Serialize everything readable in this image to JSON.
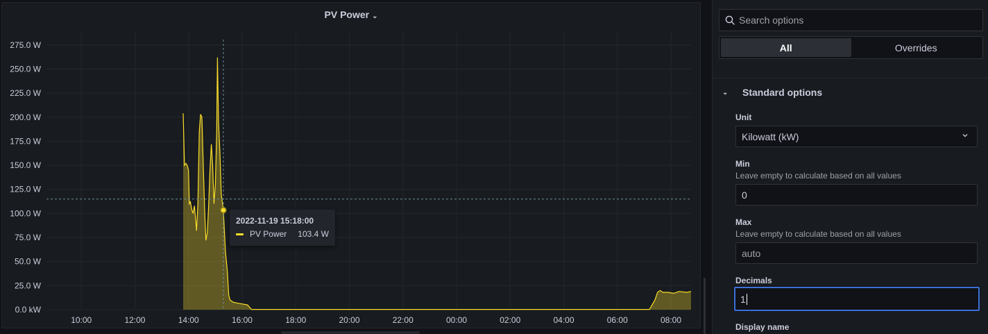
{
  "panel": {
    "title": "PV Power"
  },
  "tooltip": {
    "time": "2022-11-19 15:18:00",
    "series_name": "PV Power",
    "value": "103.4 W"
  },
  "options": {
    "search_placeholder": "Search options",
    "tabs": [
      {
        "label": "All",
        "active": true
      },
      {
        "label": "Overrides",
        "active": false
      }
    ],
    "section_title": "Standard options",
    "unit": {
      "label": "Unit",
      "value": "Kilowatt (kW)"
    },
    "min": {
      "label": "Min",
      "description": "Leave empty to calculate based on all values",
      "value": "0"
    },
    "max": {
      "label": "Max",
      "description": "Leave empty to calculate based on all values",
      "placeholder": "auto"
    },
    "decimals": {
      "label": "Decimals",
      "value": "1"
    },
    "display_name": {
      "label": "Display name"
    }
  },
  "colors": {
    "series": "#fade2a",
    "accent_focus": "#3d71d9",
    "background": "#111217",
    "panel": "#181b1f"
  },
  "chart_data": {
    "type": "area",
    "title": "PV Power",
    "series": [
      {
        "name": "PV Power",
        "x_unit": "hours since 2022-11-19 00:00",
        "points": [
          [
            13.8,
            204
          ],
          [
            13.85,
            150
          ],
          [
            13.9,
            152
          ],
          [
            13.95,
            150
          ],
          [
            14.0,
            145
          ],
          [
            14.03,
            110
          ],
          [
            14.07,
            112
          ],
          [
            14.12,
            104
          ],
          [
            14.17,
            100
          ],
          [
            14.22,
            108
          ],
          [
            14.27,
            92
          ],
          [
            14.3,
            82
          ],
          [
            14.35,
            110
          ],
          [
            14.4,
            185
          ],
          [
            14.45,
            203
          ],
          [
            14.5,
            200
          ],
          [
            14.55,
            150
          ],
          [
            14.6,
            105
          ],
          [
            14.65,
            72
          ],
          [
            14.7,
            80
          ],
          [
            14.75,
            108
          ],
          [
            14.8,
            145
          ],
          [
            14.85,
            172
          ],
          [
            14.9,
            150
          ],
          [
            14.95,
            110
          ],
          [
            15.0,
            130
          ],
          [
            15.05,
            185
          ],
          [
            15.08,
            262
          ],
          [
            15.12,
            195
          ],
          [
            15.17,
            165
          ],
          [
            15.22,
            120
          ],
          [
            15.3,
            103.4
          ],
          [
            15.38,
            60
          ],
          [
            15.45,
            40
          ],
          [
            15.5,
            15
          ],
          [
            15.55,
            10
          ],
          [
            15.65,
            8
          ],
          [
            15.8,
            7
          ],
          [
            16.0,
            6
          ],
          [
            16.2,
            5
          ],
          [
            16.35,
            0.3
          ],
          [
            17.0,
            0.3
          ],
          [
            20.0,
            0.3
          ],
          [
            23.0,
            0.3
          ],
          [
            26.0,
            0.3
          ],
          [
            29.0,
            0.3
          ],
          [
            31.2,
            0.3
          ],
          [
            31.4,
            10
          ],
          [
            31.5,
            18
          ],
          [
            31.6,
            20
          ],
          [
            31.7,
            18
          ],
          [
            31.9,
            18
          ],
          [
            32.1,
            17
          ],
          [
            32.3,
            19
          ],
          [
            32.6,
            18
          ],
          [
            32.75,
            19
          ]
        ]
      }
    ],
    "x_ticks": [
      "10:00",
      "12:00",
      "14:00",
      "16:00",
      "18:00",
      "20:00",
      "22:00",
      "00:00",
      "02:00",
      "04:00",
      "06:00",
      "08:00"
    ],
    "y_ticks": [
      "0.0 kW",
      "25.0 W",
      "50.0 W",
      "75.0 W",
      "100.0 W",
      "125.0 W",
      "150.0 W",
      "175.0 W",
      "200.0 W",
      "225.0 W",
      "250.0 W",
      "275.0 W"
    ],
    "xlim": [
      8.7,
      32.75
    ],
    "ylim": [
      0,
      290
    ],
    "crosshair": {
      "x": 15.3,
      "y": 115
    },
    "hover_point": {
      "x": 15.3,
      "y": 103.4
    },
    "grid": true,
    "legend": "none"
  }
}
